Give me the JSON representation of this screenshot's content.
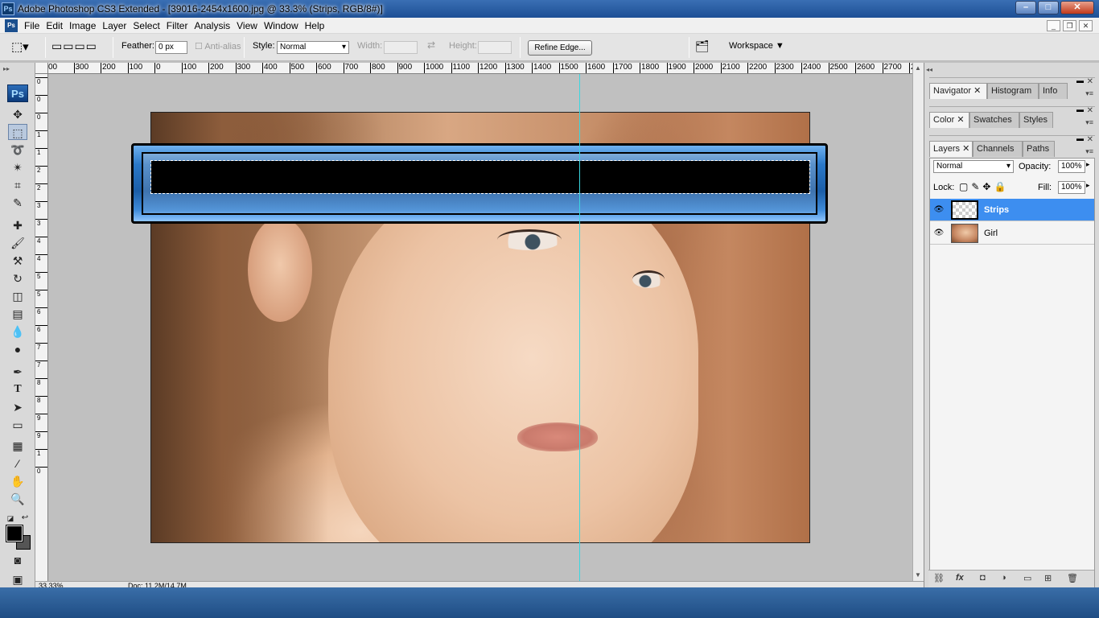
{
  "window": {
    "title": "Adobe Photoshop CS3 Extended - [39016-2454x1600.jpg @ 33.3% (Strips, RGB/8#)]",
    "app_icon": "Ps"
  },
  "menu": [
    "File",
    "Edit",
    "Image",
    "Layer",
    "Select",
    "Filter",
    "Analysis",
    "View",
    "Window",
    "Help"
  ],
  "options_bar": {
    "feather_label": "Feather:",
    "feather_value": "0 px",
    "antialias_label": "Anti-alias",
    "style_label": "Style:",
    "style_value": "Normal",
    "width_label": "Width:",
    "height_label": "Height:",
    "refine_edge": "Refine Edge...",
    "workspace": "Workspace ▼"
  },
  "ruler_top": [
    "00",
    "300",
    "200",
    "100",
    "0",
    "100",
    "200",
    "300",
    "400",
    "500",
    "600",
    "700",
    "800",
    "900",
    "1000",
    "1100",
    "1200",
    "1300",
    "1400",
    "1500",
    "1600",
    "1700",
    "1800",
    "1900",
    "2000",
    "2100",
    "2200",
    "2300",
    "2400",
    "2500",
    "2600",
    "2700",
    "28"
  ],
  "ruler_left": [
    "0",
    "0",
    "0",
    "1",
    "1",
    "2",
    "2",
    "3",
    "3",
    "4",
    "4",
    "5",
    "5",
    "6",
    "6",
    "7",
    "7",
    "8",
    "8",
    "9",
    "9",
    "1",
    "0"
  ],
  "toolbox": {
    "logo": "Ps"
  },
  "panels": {
    "group1": [
      "Navigator",
      "Histogram",
      "Info"
    ],
    "group2": [
      "Color",
      "Swatches",
      "Styles"
    ],
    "group3": [
      "Layers",
      "Channels",
      "Paths"
    ]
  },
  "layers_panel": {
    "blend_mode": "Normal",
    "opacity_label": "Opacity:",
    "opacity_value": "100%",
    "lock_label": "Lock:",
    "fill_label": "Fill:",
    "fill_value": "100%",
    "layers": [
      {
        "name": "Strips",
        "selected": true
      },
      {
        "name": "Girl",
        "selected": false
      }
    ]
  },
  "status": {
    "zoom": "33.33%",
    "doc": "Doc: 11.2M/14.7M"
  },
  "colors": {
    "guide": "#3ad6e0",
    "selected_layer": "#3d8ef0",
    "strip_blue": "#2a78c8"
  }
}
